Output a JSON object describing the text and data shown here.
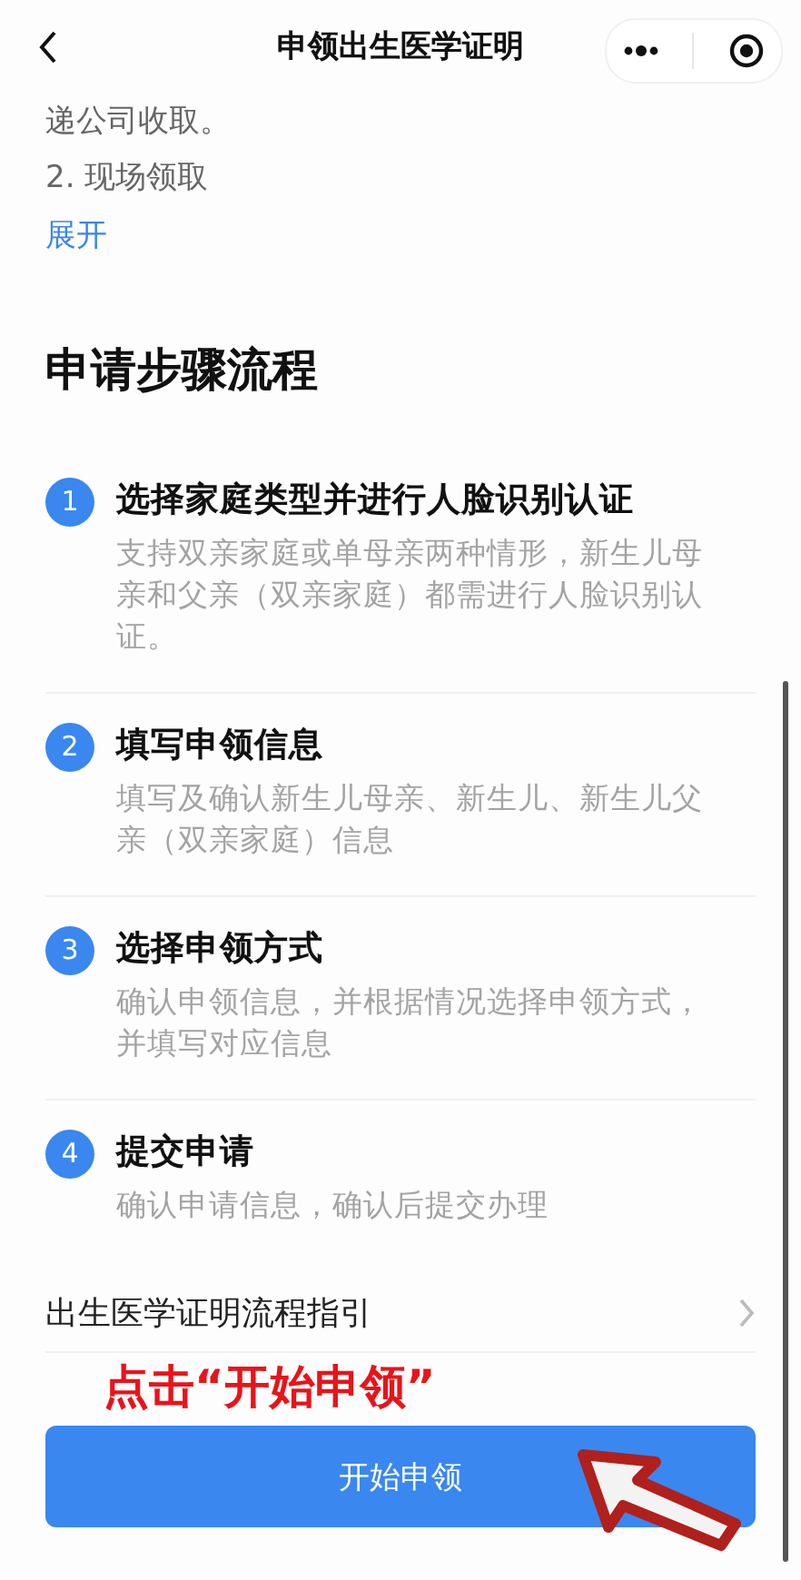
{
  "nav": {
    "title": "申领出生医学证明"
  },
  "intro": {
    "lines": [
      "递公司收取。",
      "2. 现场领取"
    ],
    "expand_link": "展开"
  },
  "section_title": "申请步骤流程",
  "steps": [
    {
      "number": "1",
      "title": "选择家庭类型并进行人脸识别认证",
      "description": "支持双亲家庭或单母亲两种情形，新生儿母亲和父亲（双亲家庭）都需进行人脸识别认证。"
    },
    {
      "number": "2",
      "title": "填写申领信息",
      "description": "填写及确认新生儿母亲、新生儿、新生儿父亲（双亲家庭）信息"
    },
    {
      "number": "3",
      "title": "选择申领方式",
      "description": "确认申领信息，并根据情况选择申领方式，并填写对应信息"
    },
    {
      "number": "4",
      "title": "提交申请",
      "description": "确认申请信息，确认后提交办理"
    }
  ],
  "guide_link": {
    "label": "出生医学证明流程指引"
  },
  "annotation": "点击“开始申领”",
  "primary_button": "开始申领"
}
